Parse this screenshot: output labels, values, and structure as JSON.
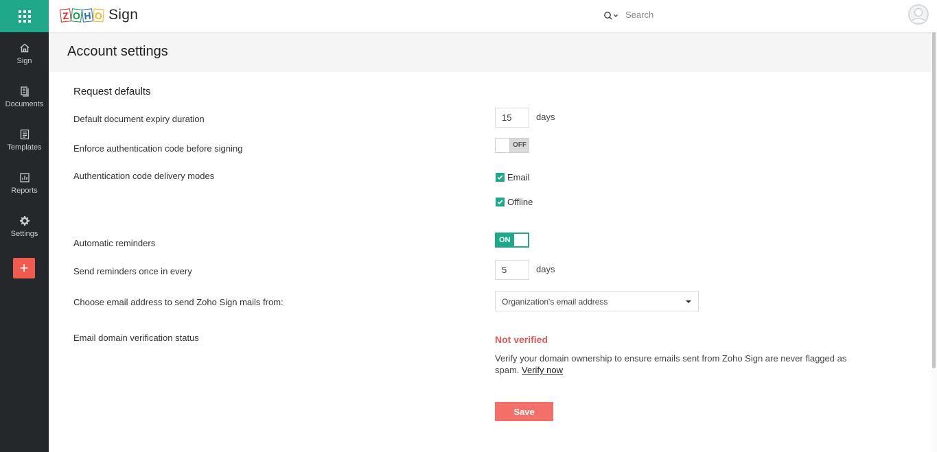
{
  "app": {
    "logo_letters": [
      "Z",
      "O",
      "H",
      "O"
    ],
    "product_name": "Sign"
  },
  "colors": {
    "brand_green": "#1fa98a",
    "sidebar_bg": "#24282b",
    "danger": "#e05a5a",
    "save_button": "#f26f6a",
    "add_button": "#ef5b4f"
  },
  "sidebar": {
    "items": [
      {
        "label": "Sign",
        "icon": "home-icon"
      },
      {
        "label": "Documents",
        "icon": "documents-icon"
      },
      {
        "label": "Templates",
        "icon": "templates-icon"
      },
      {
        "label": "Reports",
        "icon": "reports-icon"
      },
      {
        "label": "Settings",
        "icon": "gear-icon"
      }
    ],
    "add_label": "+"
  },
  "search": {
    "placeholder": "Search"
  },
  "page": {
    "title": "Account settings"
  },
  "request_defaults": {
    "title": "Request defaults",
    "expiry": {
      "label": "Default document expiry duration",
      "value": "15",
      "unit": "days"
    },
    "enforce_auth": {
      "label": "Enforce authentication code before signing",
      "state": "OFF"
    },
    "delivery_modes": {
      "label": "Authentication code delivery modes",
      "options": [
        {
          "label": "Email",
          "checked": true
        },
        {
          "label": "Offline",
          "checked": true
        }
      ]
    },
    "auto_reminders": {
      "label": "Automatic reminders",
      "state": "ON"
    },
    "reminder_interval": {
      "label": "Send reminders once in every",
      "value": "5",
      "unit": "days"
    },
    "email_from": {
      "label": "Choose email address to send Zoho Sign mails from:",
      "selected": "Organization's email address"
    },
    "domain_verification": {
      "label": "Email domain verification status",
      "status": "Not verified",
      "description": "Verify your domain ownership to ensure emails sent from Zoho Sign are never flagged as spam.",
      "link_text": "Verify now"
    },
    "save_label": "Save"
  }
}
